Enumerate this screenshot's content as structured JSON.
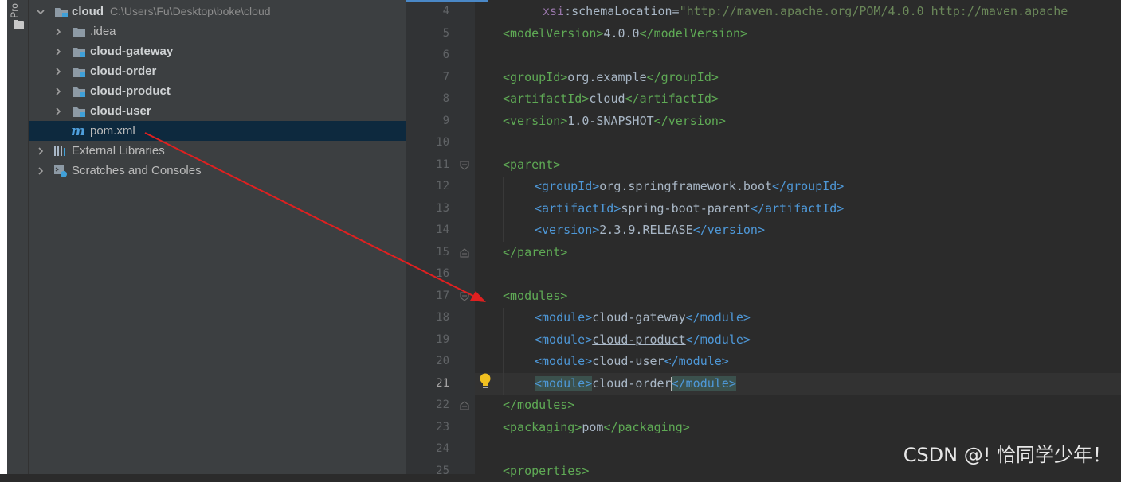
{
  "tool_window": {
    "tab_label": "Pro"
  },
  "project_tree": {
    "root": {
      "name": "cloud",
      "path": "C:\\Users\\Fu\\Desktop\\boke\\cloud"
    },
    "items": [
      {
        "label": ".idea",
        "icon": "folder-icon"
      },
      {
        "label": "cloud-gateway",
        "icon": "module-folder-icon"
      },
      {
        "label": "cloud-order",
        "icon": "module-folder-icon"
      },
      {
        "label": "cloud-product",
        "icon": "module-folder-icon"
      },
      {
        "label": "cloud-user",
        "icon": "module-folder-icon"
      },
      {
        "label": "pom.xml",
        "icon": "maven-icon"
      }
    ],
    "external_libraries": "External Libraries",
    "scratches": "Scratches and Consoles",
    "selected_item": "pom.xml"
  },
  "editor": {
    "line_numbers": [
      "4",
      "5",
      "6",
      "7",
      "8",
      "9",
      "10",
      "11",
      "12",
      "13",
      "14",
      "15",
      "16",
      "17",
      "18",
      "19",
      "20",
      "21",
      "22",
      "23",
      "24",
      "25"
    ],
    "current_line": "21",
    "lines": {
      "l4_attr": "xsi",
      "l4_rest": ":schemaLocation=",
      "l4_value": "\"http://maven.apache.org/POM/4.0.0 http://maven.apache",
      "l5_open": "<modelVersion>",
      "l5_text": "4.0.0",
      "l5_close": "</modelVersion>",
      "l7_open": "<groupId>",
      "l7_text": "org.example",
      "l7_close": "</groupId>",
      "l8_open": "<artifactId>",
      "l8_text": "cloud",
      "l8_close": "</artifactId>",
      "l9_open": "<version>",
      "l9_text": "1.0-SNAPSHOT",
      "l9_close": "</version>",
      "l11": "<parent>",
      "l12_open": "<groupId>",
      "l12_text": "org.springframework.boot",
      "l12_close": "</groupId>",
      "l13_open": "<artifactId>",
      "l13_text": "spring-boot-parent",
      "l13_close": "</artifactId>",
      "l14_open": "<version>",
      "l14_text": "2.3.9.RELEASE",
      "l14_close": "</version>",
      "l15": "</parent>",
      "l17": "<modules>",
      "l18_open": "<module>",
      "l18_text": "cloud-gateway",
      "l18_close": "</module>",
      "l19_open": "<module>",
      "l19_text": "cloud-product",
      "l19_close": "</module>",
      "l20_open": "<module>",
      "l20_text": "cloud-user",
      "l20_close": "</module>",
      "l21_open": "<module>",
      "l21_text": "cloud-order",
      "l21_close": "</module>",
      "l22": "</modules>",
      "l23_open": "<packaging>",
      "l23_text": "pom",
      "l23_close": "</packaging>",
      "l25": "<properties>"
    }
  },
  "watermark": "CSDN @! 恰同学少年！",
  "colors": {
    "xml_tag_green": "#5faa55",
    "xml_tag_blue": "#4e98d8",
    "annotation_arrow": "#e02020",
    "selection": "#0d293e"
  }
}
